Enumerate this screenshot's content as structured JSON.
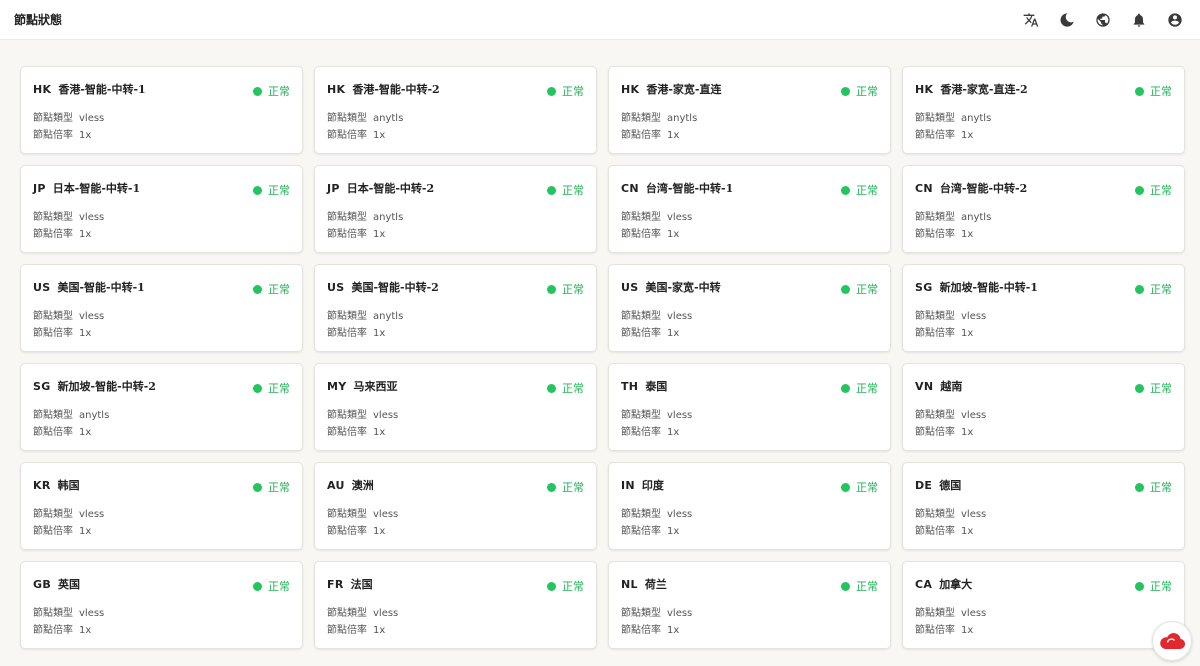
{
  "header": {
    "title": "節點狀態"
  },
  "toolbar_icons": [
    "translate-icon",
    "moon-icon",
    "globe-icon",
    "bell-icon",
    "user-icon"
  ],
  "labels": {
    "type": "節點類型",
    "rate": "節點倍率",
    "status": "正常"
  },
  "colors": {
    "status_green": "#22c55e",
    "accent_red": "#e0282e"
  },
  "nodes": [
    {
      "code": "HK",
      "name": "香港-智能-中转-1",
      "type": "vless",
      "rate": "1x"
    },
    {
      "code": "HK",
      "name": "香港-智能-中转-2",
      "type": "anytls",
      "rate": "1x"
    },
    {
      "code": "HK",
      "name": "香港-家宽-直连",
      "type": "anytls",
      "rate": "1x"
    },
    {
      "code": "HK",
      "name": "香港-家宽-直连-2",
      "type": "anytls",
      "rate": "1x"
    },
    {
      "code": "JP",
      "name": "日本-智能-中转-1",
      "type": "vless",
      "rate": "1x"
    },
    {
      "code": "JP",
      "name": "日本-智能-中转-2",
      "type": "anytls",
      "rate": "1x"
    },
    {
      "code": "CN",
      "name": "台湾-智能-中转-1",
      "type": "vless",
      "rate": "1x"
    },
    {
      "code": "CN",
      "name": "台湾-智能-中转-2",
      "type": "anytls",
      "rate": "1x"
    },
    {
      "code": "US",
      "name": "美国-智能-中转-1",
      "type": "vless",
      "rate": "1x"
    },
    {
      "code": "US",
      "name": "美国-智能-中转-2",
      "type": "anytls",
      "rate": "1x"
    },
    {
      "code": "US",
      "name": "美国-家宽-中转",
      "type": "vless",
      "rate": "1x"
    },
    {
      "code": "SG",
      "name": "新加坡-智能-中转-1",
      "type": "vless",
      "rate": "1x"
    },
    {
      "code": "SG",
      "name": "新加坡-智能-中转-2",
      "type": "anytls",
      "rate": "1x"
    },
    {
      "code": "MY",
      "name": "马来西亚",
      "type": "vless",
      "rate": "1x"
    },
    {
      "code": "TH",
      "name": "泰国",
      "type": "vless",
      "rate": "1x"
    },
    {
      "code": "VN",
      "name": "越南",
      "type": "vless",
      "rate": "1x"
    },
    {
      "code": "KR",
      "name": "韩国",
      "type": "vless",
      "rate": "1x"
    },
    {
      "code": "AU",
      "name": "澳洲",
      "type": "vless",
      "rate": "1x"
    },
    {
      "code": "IN",
      "name": "印度",
      "type": "vless",
      "rate": "1x"
    },
    {
      "code": "DE",
      "name": "德国",
      "type": "vless",
      "rate": "1x"
    },
    {
      "code": "GB",
      "name": "英国",
      "type": "vless",
      "rate": "1x"
    },
    {
      "code": "FR",
      "name": "法国",
      "type": "vless",
      "rate": "1x"
    },
    {
      "code": "NL",
      "name": "荷兰",
      "type": "vless",
      "rate": "1x"
    },
    {
      "code": "CA",
      "name": "加拿大",
      "type": "vless",
      "rate": "1x"
    }
  ]
}
